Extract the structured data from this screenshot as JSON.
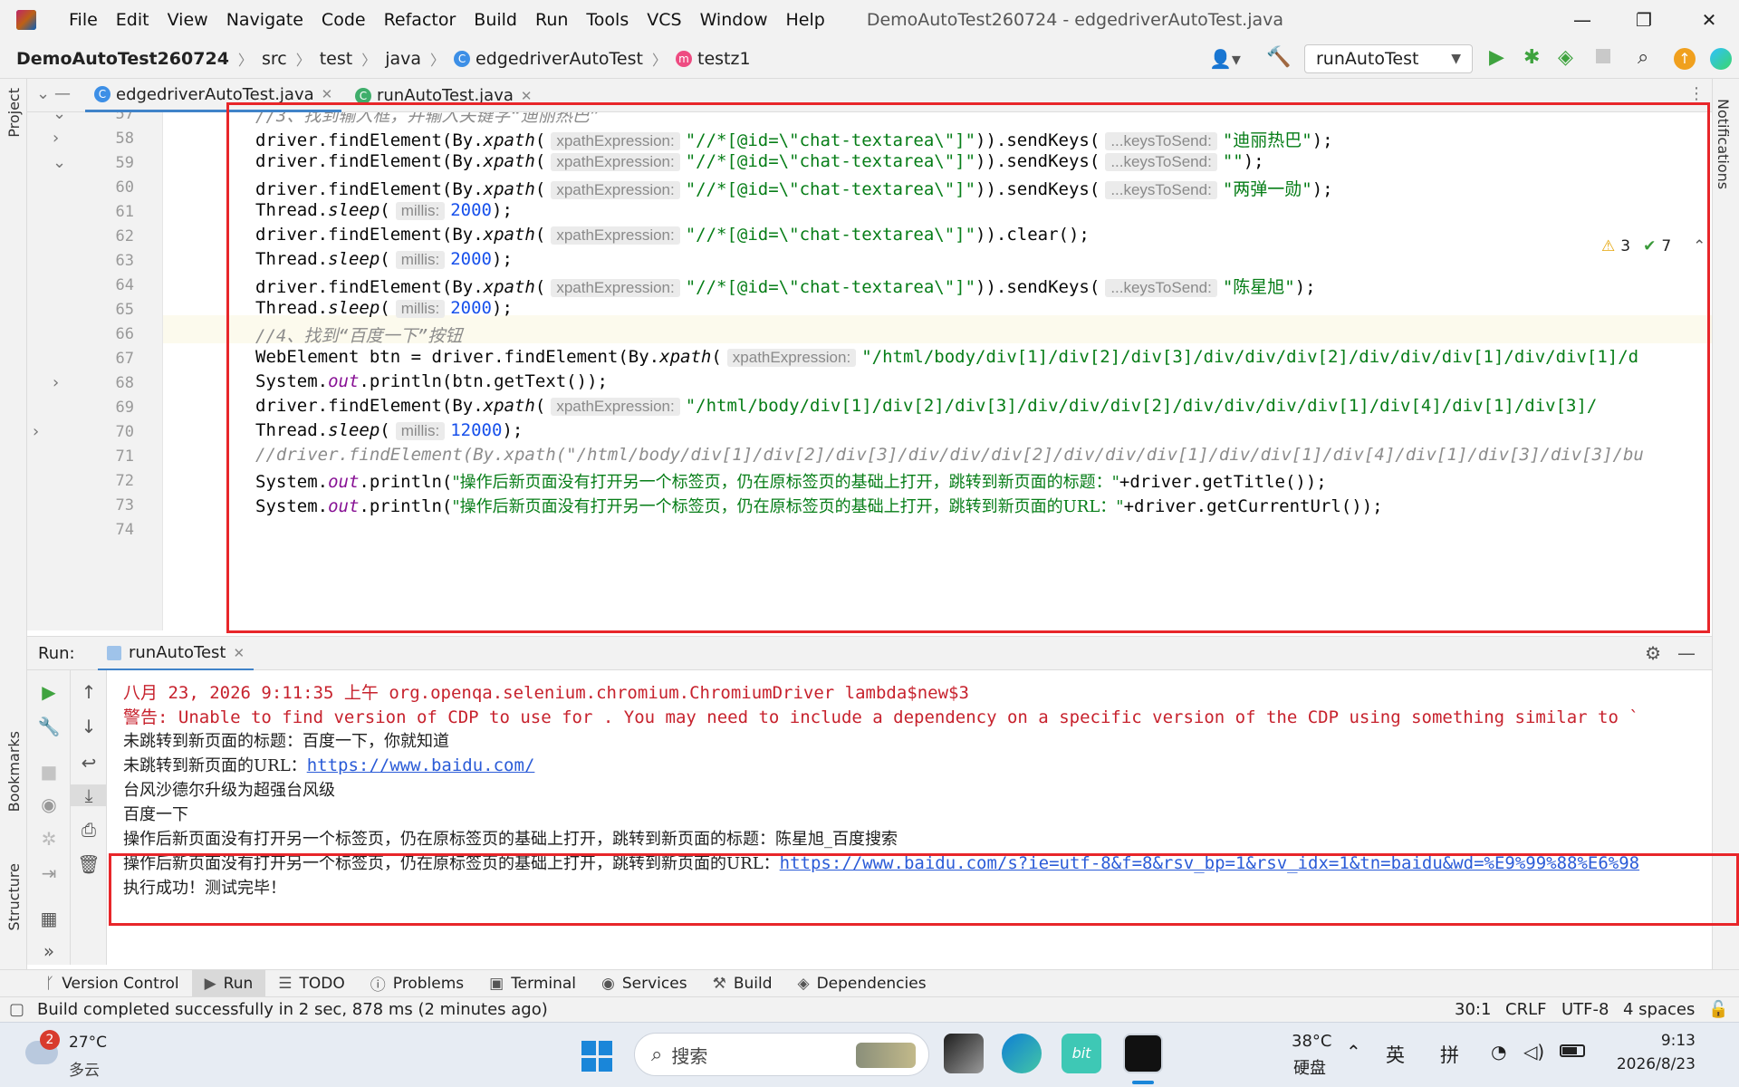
{
  "window": {
    "title": "DemoAutoTest260724 - edgedriverAutoTest.java",
    "menu": [
      "File",
      "Edit",
      "View",
      "Navigate",
      "Code",
      "Refactor",
      "Build",
      "Run",
      "Tools",
      "VCS",
      "Window",
      "Help"
    ],
    "menu_mnemonic": [
      "F",
      "E",
      "V",
      "N",
      "C",
      "R",
      "B",
      "R",
      "T",
      "V",
      "W",
      "H"
    ],
    "controls": {
      "minimize": "—",
      "maximize": "❐",
      "close": "✕"
    }
  },
  "breadcrumb": {
    "project": "DemoAutoTest260724",
    "items": [
      "src",
      "test",
      "java",
      "edgedriverAutoTest",
      "testz1"
    ]
  },
  "run_config": {
    "label": "runAutoTest"
  },
  "left_strip": {
    "project": "Project",
    "bookmarks": "Bookmarks",
    "structure": "Structure"
  },
  "right_strip": {
    "notifications": "Notifications"
  },
  "editor_tabs": [
    {
      "label": "edgedriverAutoTest.java"
    },
    {
      "label": "runAutoTest.java"
    }
  ],
  "inspection": {
    "warnings": "3",
    "checks": "7"
  },
  "code": {
    "lines": [
      {
        "n": "57",
        "t": "comment",
        "text": "//3、找到输入框，并输入关键字“迪丽热巴”"
      },
      {
        "n": "58",
        "t": "sendkeys",
        "value": "\"迪丽热巴\""
      },
      {
        "n": "59",
        "t": "sendkeys",
        "value": "\"\""
      },
      {
        "n": "60",
        "t": "sendkeys",
        "value": "\"两弹一勋\""
      },
      {
        "n": "61",
        "t": "sleep",
        "value": "2000"
      },
      {
        "n": "62",
        "t": "clear"
      },
      {
        "n": "63",
        "t": "sleep",
        "value": "2000"
      },
      {
        "n": "64",
        "t": "sendkeys",
        "value": "\"陈星旭\""
      },
      {
        "n": "65",
        "t": "sleep",
        "value": "2000"
      },
      {
        "n": "66",
        "t": "comment",
        "text": "//4、找到“百度一下”按钮"
      },
      {
        "n": "67",
        "t": "webelement"
      },
      {
        "n": "68",
        "t": "println_btn"
      },
      {
        "n": "69",
        "t": "click_xpath"
      },
      {
        "n": "70",
        "t": "sleep",
        "value": "12000"
      },
      {
        "n": "71",
        "t": "comment",
        "text": "//driver.findElement(By.xpath(\"/html/body/div[1]/div[2]/div[3]/div/div/div[2]/div/div/div[1]/div/div[1]/div[4]/div[1]/div[3]/div[3]/bu"
      },
      {
        "n": "72",
        "t": "println_title"
      },
      {
        "n": "73",
        "t": "println_url"
      },
      {
        "n": "74",
        "t": "blank"
      }
    ],
    "tokens": {
      "driver_find": "driver.findElement(By.",
      "xpath_fn": "xpath",
      "open": "(",
      "hint_xpath": "xpathExpression:",
      "hint_keys": "...keysToSend:",
      "hint_millis": "millis:",
      "textarea_xpath": "\"//*[@id=\\\"chat-textarea\\\"]\"",
      "send_keys": ")).sendKeys(",
      "close_semi": ");",
      "clear": ")).clear();",
      "thread": "Thread.",
      "sleep": "sleep",
      "webelement_prefix": "WebElement btn = driver.findElement(By.",
      "btn_xpath": "\"/html/body/div[1]/div[2]/div[3]/div/div/div[2]/div/div/div[1]/div/div[1]/d",
      "click_path": "\"/html/body/div[1]/div[2]/div[3]/div/div/div[2]/div/div/div/div[1]/div[4]/div[1]/div[3]/",
      "system": "System.",
      "out": "out",
      "println_btn": ".println(btn.getText());",
      "println_open": ".println(",
      "title_str": "\"操作后新页面没有打开另一个标签页，仍在原标签页的基础上打开，跳转到新页面的标题：\"",
      "title_tail": "+driver.getTitle());",
      "url_str": "\"操作后新页面没有打开另一个标签页，仍在原标签页的基础上打开，跳转到新页面的URL：\"",
      "url_tail": "+driver.getCurrentUrl());"
    }
  },
  "run_panel": {
    "label": "Run:",
    "tab": "runAutoTest",
    "console": [
      {
        "cls": "err",
        "text": "八月 23, 2026 9:11:35 上午 org.openqa.selenium.chromium.ChromiumDriver lambda$new$3"
      },
      {
        "cls": "err",
        "text": "警告: Unable to find version of CDP to use for . You may need to include a dependency on a specific version of the CDP using something similar to `"
      },
      {
        "cls": "",
        "text": "未跳转到新页面的标题：百度一下，你就知道"
      },
      {
        "cls": "",
        "prefix": "未跳转到新页面的URL：",
        "link": "https://www.baidu.com/"
      },
      {
        "cls": "",
        "text": "台风沙德尔升级为超强台风级"
      },
      {
        "cls": "",
        "text": "百度一下"
      },
      {
        "cls": "",
        "text": "操作后新页面没有打开另一个标签页，仍在原标签页的基础上打开，跳转到新页面的标题：陈星旭_百度搜索"
      },
      {
        "cls": "",
        "prefix": "操作后新页面没有打开另一个标签页，仍在原标签页的基础上打开，跳转到新页面的URL：",
        "link": "https://www.baidu.com/s?ie=utf-8&f=8&rsv_bp=1&rsv_idx=1&tn=baidu&wd=%E9%99%88%E6%98"
      },
      {
        "cls": "",
        "text": "执行成功！测试完毕！"
      }
    ]
  },
  "tool_tabs": [
    "Version Control",
    "Run",
    "TODO",
    "Problems",
    "Terminal",
    "Services",
    "Build",
    "Dependencies"
  ],
  "status": {
    "message": "Build completed successfully in 2 sec, 878 ms (2 minutes ago)",
    "position": "30:1",
    "line_sep": "CRLF",
    "encoding": "UTF-8",
    "indent": "4 spaces"
  },
  "taskbar": {
    "weather_temp": "27°C",
    "weather_desc": "多云",
    "weather_badge": "2",
    "search_placeholder": "搜索",
    "cpu_temp": "38°C",
    "cpu_label": "硬盘",
    "ime1": "英",
    "ime2": "拼",
    "time": "9:13",
    "date": "2026/8/23"
  },
  "colors": {
    "accent": "#4083c9",
    "highlight_box": "#e8262a",
    "string": "#067d17",
    "number": "#1750eb",
    "comment": "#8c8c8c"
  }
}
